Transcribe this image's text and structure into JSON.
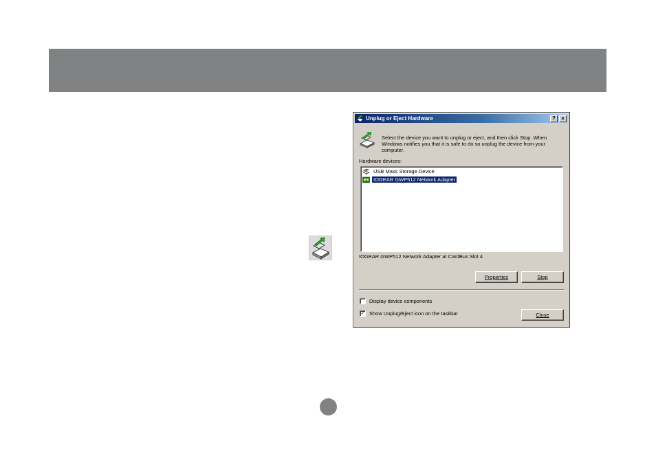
{
  "dialog": {
    "title": "Unplug or Eject Hardware",
    "help_button": "?",
    "close_glyph": "×",
    "instructions": "Select the device you want to unplug or eject, and then click Stop. When Windows notifies you that it is safe to do so unplug the device from your computer.",
    "hardware_label": "Hardware devices:",
    "devices": [
      {
        "label": "USB Mass Storage Device",
        "icon": "usb-storage-icon",
        "selected": false
      },
      {
        "label": "IOGEAR GWP512 Network Adapter",
        "icon": "network-adapter-icon",
        "selected": true
      }
    ],
    "status_text": "IOGEAR GWP512 Network Adapter at CardBus Slot 4",
    "properties_button": "Properties",
    "stop_button": "Stop",
    "close_button": "Close",
    "display_components_label": "Display device components",
    "display_components_checked": false,
    "show_icon_label": "Show Unplug/Eject icon on the taskbar",
    "show_icon_checked": true,
    "check_glyph": "✓"
  },
  "colors": {
    "header_band": "#808283",
    "titlebar_start": "#0a246a",
    "selection": "#0a246a",
    "dialog_face": "#d4d0c8",
    "page_dot": "#828282"
  }
}
